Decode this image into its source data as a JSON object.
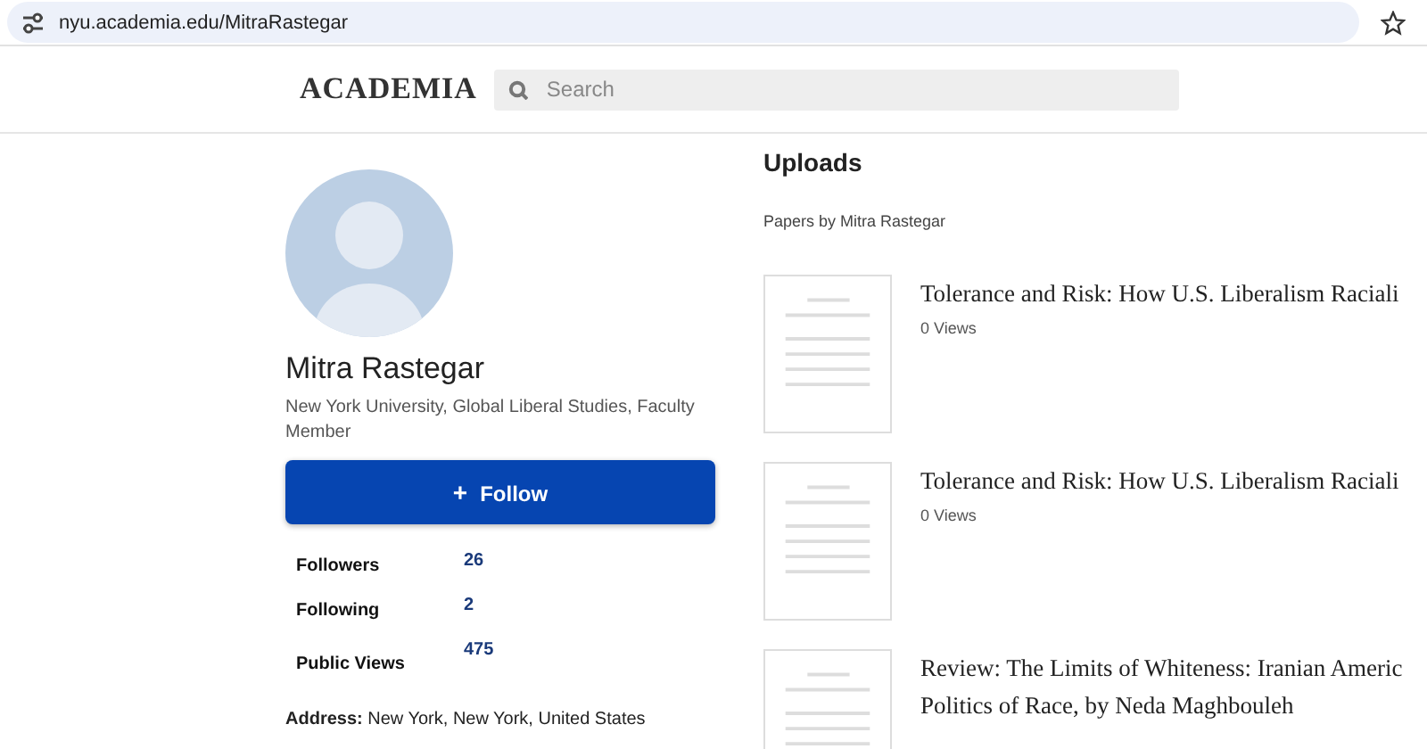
{
  "browser": {
    "url": "nyu.academia.edu/MitraRastegar"
  },
  "header": {
    "logo": "ACADEMIA",
    "search": {
      "placeholder": "Search"
    }
  },
  "profile": {
    "name": "Mitra Rastegar",
    "affiliation": "New York University, Global Liberal Studies, Faculty Member",
    "follow_button": {
      "icon": "+",
      "label": "Follow"
    },
    "stats": [
      {
        "label": "Followers",
        "value": "26"
      },
      {
        "label": "Following",
        "value": "2"
      },
      {
        "label": "Public Views",
        "value": "475"
      }
    ],
    "address": "**Address:** New York, New York, United States"
  },
  "uploads": {
    "heading": "Uploads",
    "subheading": "Papers by Mitra Rastegar",
    "papers": [
      {
        "title_lines": [
          "Tolerance and Risk: How U.S. Liberalism Raciali"
        ],
        "views": "0 Views"
      },
      {
        "title_lines": [
          "Tolerance and Risk: How U.S. Liberalism Raciali"
        ],
        "views": "0 Views"
      },
      {
        "title_lines": [
          "Review: The Limits of Whiteness: Iranian Americ",
          "Politics of Race, by Neda Maghbouleh"
        ]
      }
    ]
  }
}
